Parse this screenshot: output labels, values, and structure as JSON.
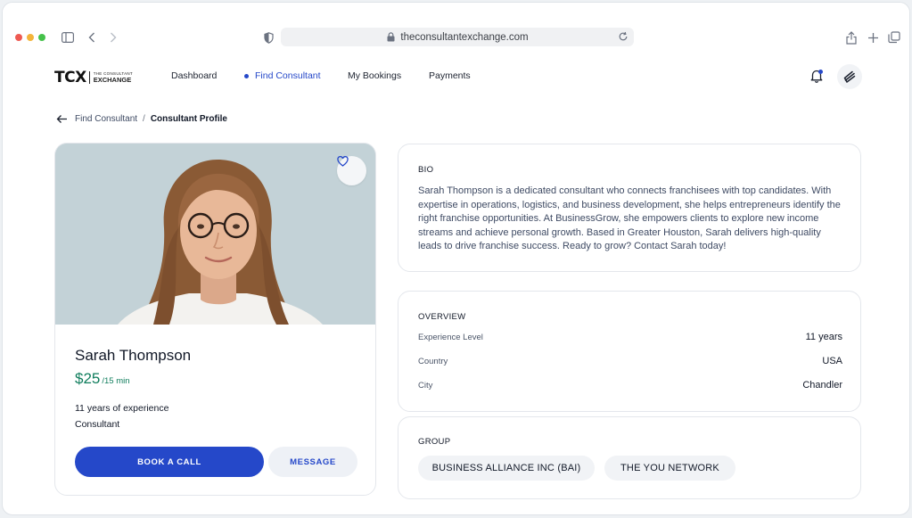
{
  "browser": {
    "url": "theconsultantexchange.com"
  },
  "brand": {
    "logo_mark": "TCX",
    "logo_small": "THE CONSULTANT",
    "logo_big": "EXCHANGE"
  },
  "nav": {
    "items": [
      {
        "label": "Dashboard",
        "active": false
      },
      {
        "label": "Find Consultant",
        "active": true
      },
      {
        "label": "My Bookings",
        "active": false
      },
      {
        "label": "Payments",
        "active": false
      }
    ],
    "has_notification": true
  },
  "breadcrumb": {
    "parent": "Find Consultant",
    "separator": "/",
    "current": "Consultant Profile"
  },
  "profile": {
    "name": "Sarah Thompson",
    "price": "$25",
    "price_unit": "/15 min",
    "experience": "11 years of experience",
    "role": "Consultant",
    "book_label": "BOOK A CALL",
    "message_label": "MESSAGE"
  },
  "bio": {
    "heading": "BIO",
    "text": "Sarah Thompson is a dedicated consultant who connects franchisees with top candidates. With expertise in operations, logistics, and business development, she helps entrepreneurs identify the right franchise opportunities. At BusinessGrow, she empowers clients to explore new income streams and achieve personal growth. Based in Greater Houston, Sarah delivers high-quality leads to drive franchise success. Ready to grow? Contact Sarah today!"
  },
  "overview": {
    "heading": "OVERVIEW",
    "rows": [
      {
        "label": "Experience Level",
        "value": "11 years"
      },
      {
        "label": "Country",
        "value": "USA"
      },
      {
        "label": "City",
        "value": "Chandler"
      }
    ]
  },
  "group": {
    "heading": "GROUP",
    "chips": [
      "BUSINESS ALLIANCE INC (BAI)",
      "THE YOU NETWORK"
    ]
  },
  "colors": {
    "primary": "#2548c9",
    "price": "#0f7d5c",
    "photo_bg": "#c3d2d7"
  },
  "icons": [
    "sidebar-icon",
    "chevron-left-icon",
    "chevron-right-icon",
    "shield-icon",
    "lock-icon",
    "reload-icon",
    "share-icon",
    "plus-icon",
    "tabs-icon",
    "bell-icon",
    "layers-icon",
    "arrow-left-icon",
    "heart-icon"
  ]
}
